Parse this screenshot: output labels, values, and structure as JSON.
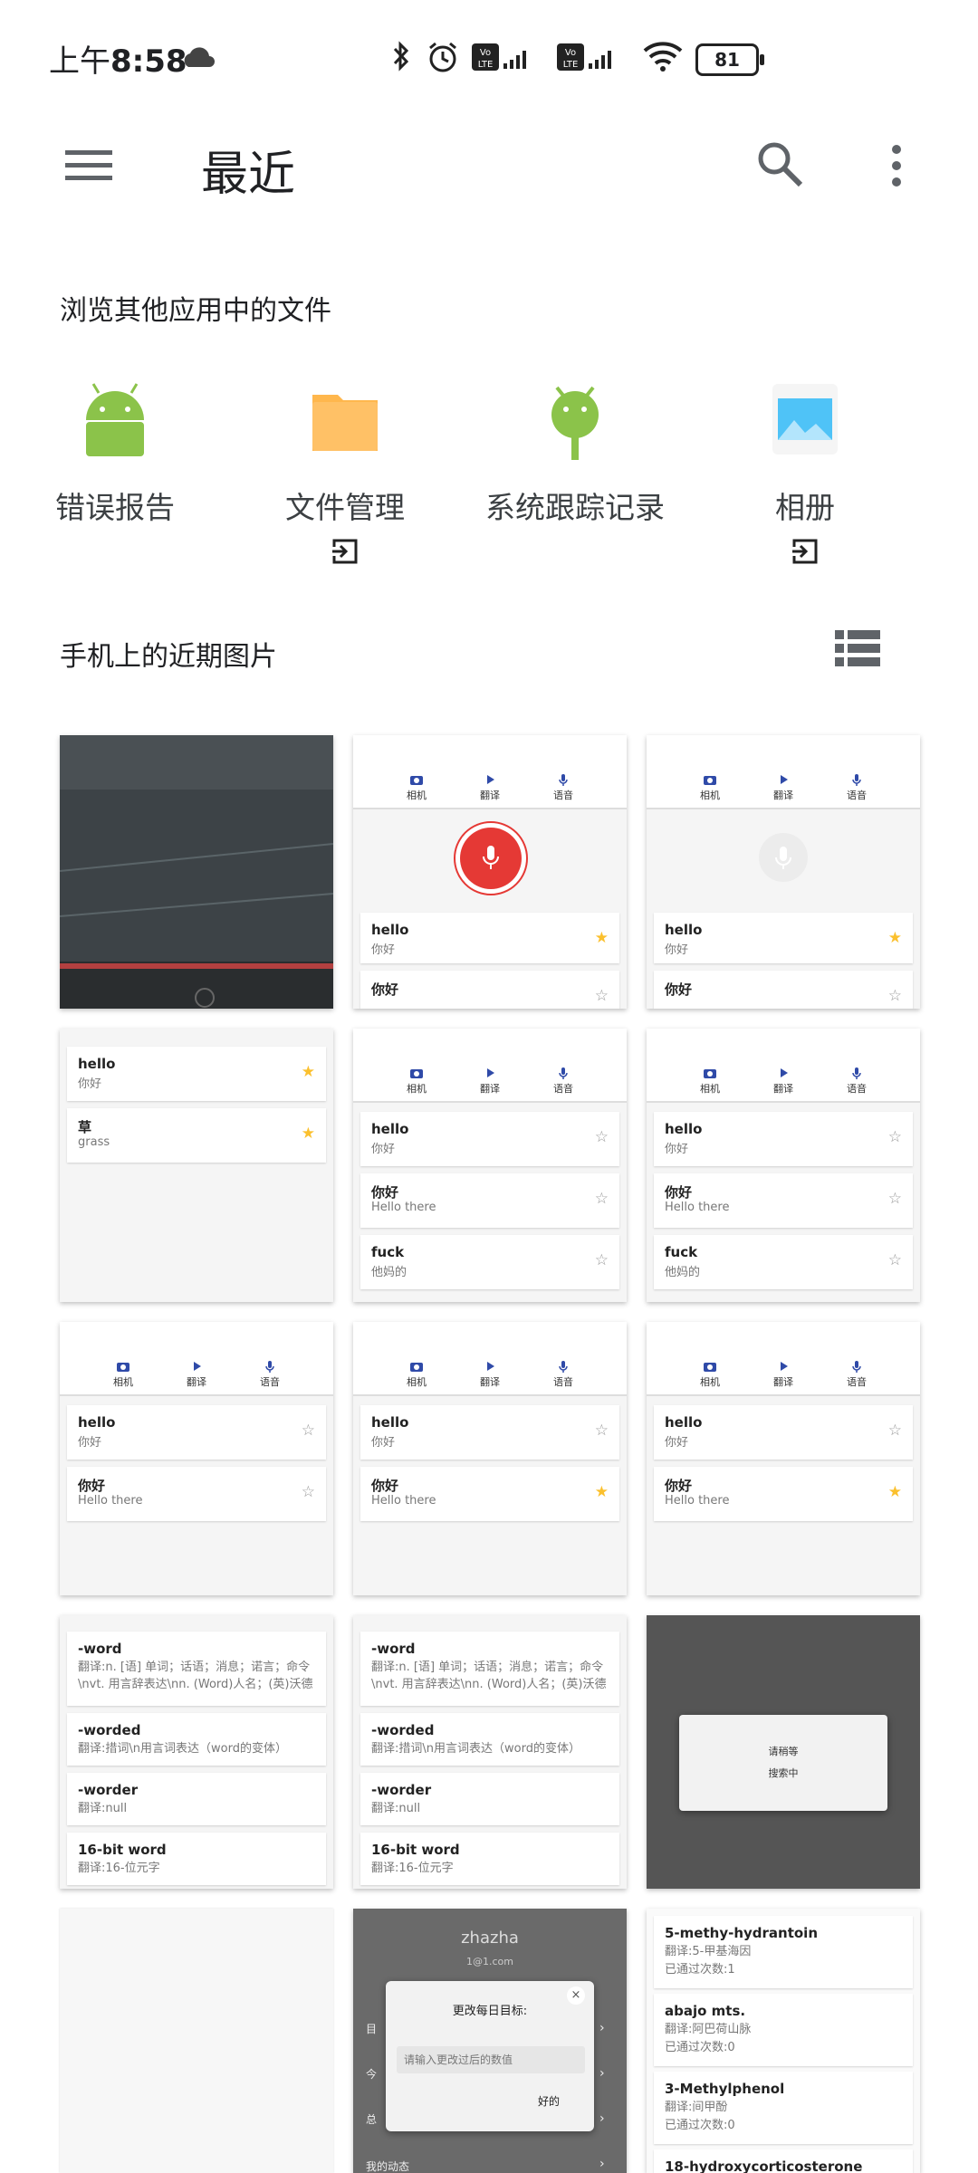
{
  "status_bar": {
    "time_prefix": "上午",
    "time": "8:58",
    "battery": "81"
  },
  "toolbar": {
    "title": "最近"
  },
  "browse": {
    "title": "浏览其他应用中的文件",
    "apps": [
      {
        "label": "错误报告"
      },
      {
        "label": "文件管理"
      },
      {
        "label": "系统跟踪记录"
      },
      {
        "label": "相册"
      }
    ]
  },
  "recent": {
    "title": "手机上的近期图片"
  },
  "tabs": {
    "camera": "相机",
    "translate": "翻译",
    "voice": "语音"
  },
  "cards": {
    "hello": "hello",
    "hello_tr": "你好",
    "nihao": "你好",
    "nihao_tr": "Hello there",
    "cao": "草",
    "cao_tr": "grass",
    "fuck": "fuck",
    "fuck_tr": "他妈的"
  },
  "dict": {
    "word": "-word",
    "word_tr": "翻译:n. [语] 单词；话语；消息；诺言；命令\\nvt. 用言辞表达\\nn. (Word)人名；(英)沃德",
    "worded": "-worded",
    "worded_tr": "翻译:措词\\n用言词表达（word的变体）",
    "worder": "-worder",
    "worder_tr": "翻译:null",
    "bit": "16-bit word",
    "bit_tr": "翻译:16-位元字"
  },
  "search_dialog": {
    "line1": "请稍等",
    "line2": "搜索中"
  },
  "goal_dialog": {
    "header": "zhazha",
    "sub": "1@1.com",
    "title": "更改每日目标:",
    "placeholder": "请输入更改过后的数值",
    "ok": "好的",
    "row_a": "目",
    "row_b": "今",
    "row_c": "总",
    "row_d": "我的动态"
  },
  "study": {
    "w1": "5-methy-hydrantoin",
    "w1_tr": "翻译:5-甲基海因",
    "w1_cnt": "已通过次数:1",
    "w2": "abajo mts.",
    "w2_tr": "翻译:阿巴荷山脉",
    "w2_cnt": "已通过次数:0",
    "w3": "3-Methylphenol",
    "w3_tr": "翻译:间甲酚",
    "w3_cnt": "已通过次数:0",
    "w4": "18-hydroxycorticosterone"
  }
}
